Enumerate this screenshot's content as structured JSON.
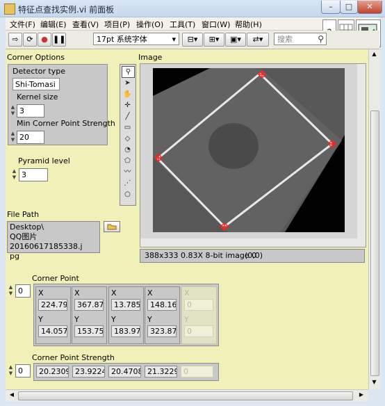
{
  "window": {
    "title": "特征点查找实例.vi 前面板",
    "minimize": "–",
    "maximize": "□",
    "close": "✕"
  },
  "menu": [
    "文件(F)",
    "编辑(E)",
    "查看(V)",
    "项目(P)",
    "操作(O)",
    "工具(T)",
    "窗口(W)",
    "帮助(H)"
  ],
  "toolbar": {
    "font": "17pt 系统字体",
    "search_placeholder": "搜索"
  },
  "corner_options": {
    "label": "Corner Options",
    "detector_label": "Detector type",
    "detector_value": "Shi-Tomasi",
    "kernel_label": "Kernel size",
    "kernel_value": "3",
    "min_strength_label": "Min Corner Point Strength",
    "min_strength_value": "20"
  },
  "pyramid": {
    "label": "Pyramid level",
    "value": "3"
  },
  "file_path": {
    "label": "File Path",
    "value_line1": "Desktop\\",
    "value_line2": "QQ图片20160617185338.j",
    "value_line3": "pg"
  },
  "image": {
    "label": "Image",
    "status": "388x333 0.83X 8-bit image 0",
    "coords": "(0,0)"
  },
  "corner_point": {
    "label": "Corner Point",
    "index": "0",
    "x_label": "X",
    "y_label": "Y",
    "x": [
      "224.791",
      "367.876",
      "13.7857",
      "148.166",
      "0"
    ],
    "y": [
      "14.0576",
      "153.757",
      "183.979",
      "323.873",
      "0"
    ]
  },
  "corner_strength": {
    "label": "Corner Point Strength",
    "index": "0",
    "values": [
      "20.2309",
      "23.9224",
      "20.4708",
      "21.3229",
      "0"
    ]
  }
}
